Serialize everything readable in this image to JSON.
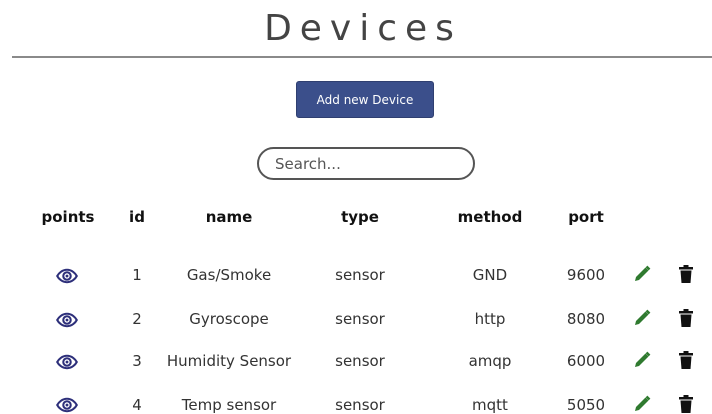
{
  "page": {
    "title": "Devices"
  },
  "toolbar": {
    "add_label": "Add new Device"
  },
  "search": {
    "placeholder": "Search..."
  },
  "table": {
    "headers": {
      "points": "points",
      "id": "id",
      "name": "name",
      "type": "type",
      "method": "method",
      "port": "port"
    },
    "rows": [
      {
        "id": "1",
        "name": "Gas/Smoke",
        "type": "sensor",
        "method": "GND",
        "port": "9600"
      },
      {
        "id": "2",
        "name": "Gyroscope",
        "type": "sensor",
        "method": "http",
        "port": "8080"
      },
      {
        "id": "3",
        "name": "Humidity Sensor",
        "type": "sensor",
        "method": "amqp",
        "port": "6000"
      },
      {
        "id": "4",
        "name": "Temp sensor",
        "type": "sensor",
        "method": "mqtt",
        "port": "5050"
      }
    ]
  },
  "icons": {
    "view": "eye-icon",
    "edit": "pencil-icon",
    "delete": "trash-icon"
  },
  "colors": {
    "accent": "#3b4f8b",
    "eye": "#2d2f7a",
    "edit": "#2f7a2f",
    "delete": "#111111"
  }
}
